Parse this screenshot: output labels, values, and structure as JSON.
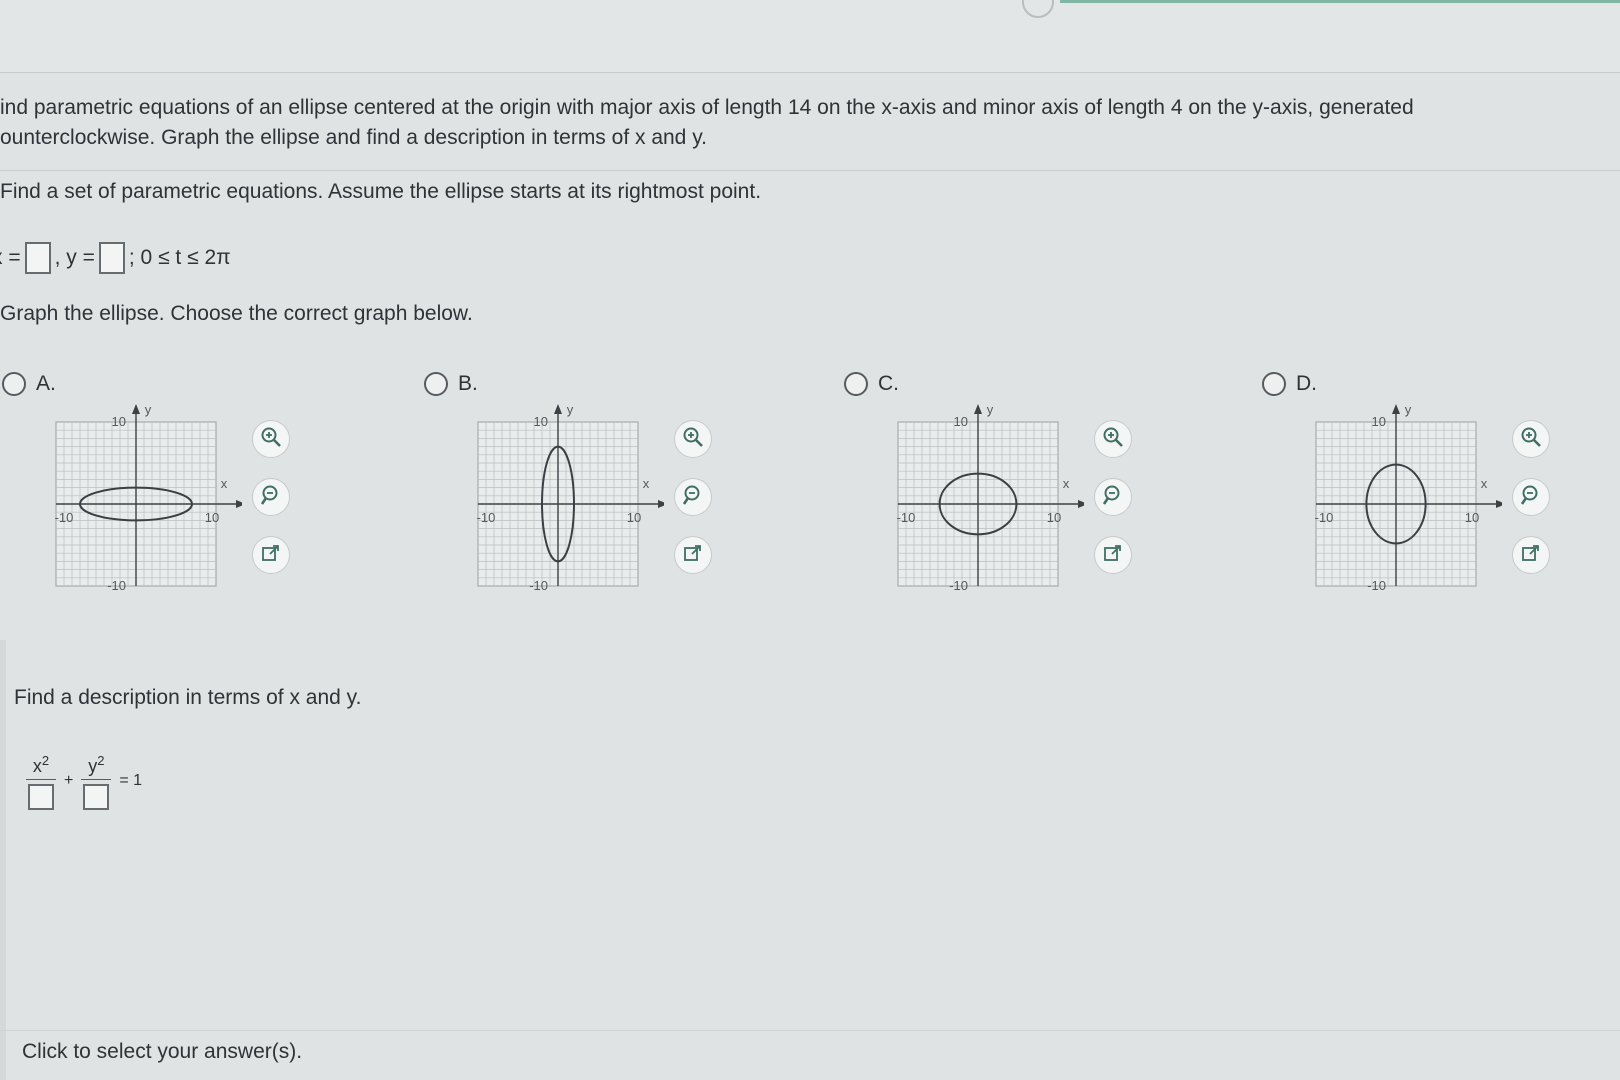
{
  "question": {
    "line1": "ind parametric equations of an ellipse centered at the origin with major axis of length 14 on the x-axis and minor axis of length 4 on the y-axis, generated",
    "line2": "ounterclockwise. Graph the ellipse and find a description in terms of x and y."
  },
  "part1": {
    "instruction": "Find a set of parametric equations. Assume the ellipse starts at its rightmost point.",
    "x_prefix": "x =",
    "y_prefix": ", y =",
    "range": "; 0 ≤ t ≤ 2π"
  },
  "part2": {
    "instruction": "Graph the ellipse. Choose the correct graph below.",
    "options": [
      {
        "label": "A.",
        "rx": 7,
        "ry": 2
      },
      {
        "label": "B.",
        "rx": 2,
        "ry": 7
      },
      {
        "label": "C.",
        "rx": 4.8,
        "ry": 3.7
      },
      {
        "label": "D.",
        "rx": 3.7,
        "ry": 4.8
      }
    ],
    "axis": {
      "min": -10,
      "max": 10,
      "tick_pos": "10",
      "tick_neg": "-10",
      "xlabel": "x",
      "ylabel": "y"
    },
    "tools": [
      "zoom-in-icon",
      "zoom-out-icon",
      "popout-icon"
    ]
  },
  "part3": {
    "instruction": "Find a description in terms of x and y.",
    "x_num": "x",
    "y_num": "y",
    "exponent": "2",
    "plus": "+",
    "equals": "= 1"
  },
  "footer": {
    "text": "Click to select your answer(s)."
  }
}
